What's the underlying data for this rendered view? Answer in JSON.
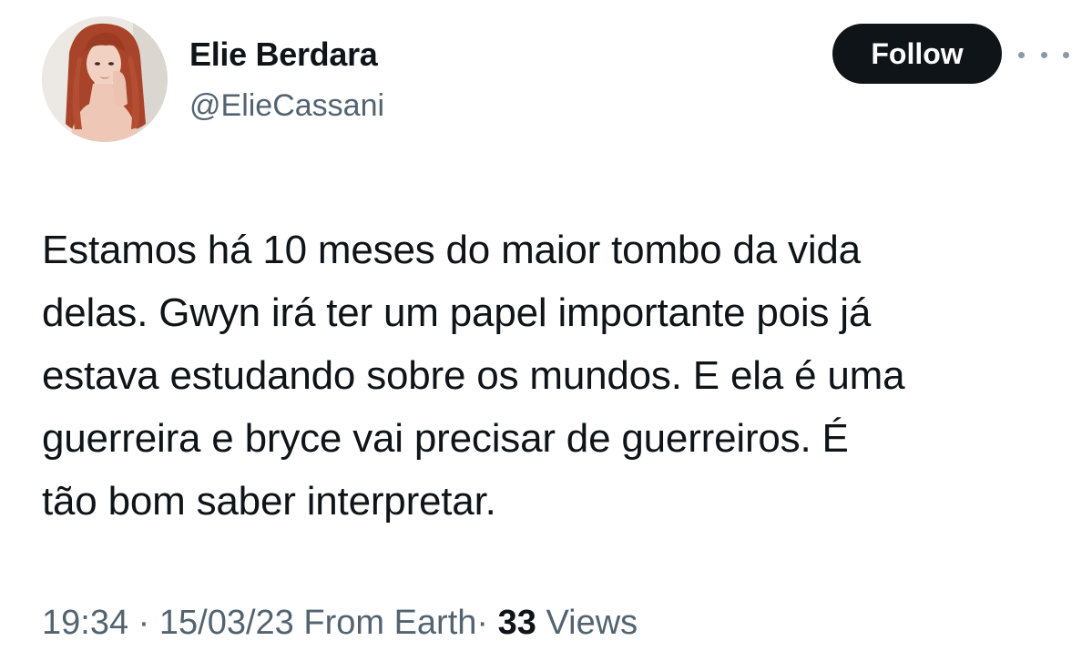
{
  "author": {
    "display_name": "Elie Berdara",
    "handle": "@ElieCassani",
    "avatar_icon": "profile-photo"
  },
  "actions": {
    "follow_label": "Follow",
    "more_icon": "more-horizontal-icon"
  },
  "tweet": {
    "lines": [
      "Estamos há 10 meses do maior tombo da vida",
      "delas. Gwyn irá ter um papel importante pois já",
      "estava estudando sobre os mundos. E ela é uma",
      "guerreira e bryce vai precisar de guerreiros. É",
      "tão bom saber interpretar."
    ]
  },
  "meta": {
    "time": "19:34",
    "date": "15/03/23",
    "source": "From Earth",
    "separator": "·",
    "views_count": "33",
    "views_label": "Views"
  },
  "colors": {
    "text_primary": "#0f1419",
    "text_secondary": "#536471",
    "button_bg": "#0f1419",
    "button_text": "#ffffff",
    "hair": "#a8442a"
  }
}
